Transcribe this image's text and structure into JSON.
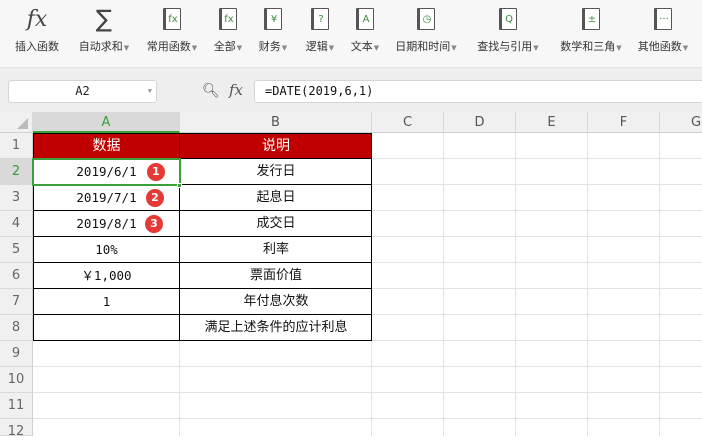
{
  "toolbar": [
    {
      "label": "插入函数",
      "icon": "fx-icon",
      "caret": false
    },
    {
      "label": "自动求和",
      "icon": "sigma-icon",
      "caret": true
    },
    {
      "label": "常用函数",
      "icon": "fx-star-icon",
      "caret": true
    },
    {
      "label": "全部",
      "icon": "fx-book-icon",
      "caret": true
    },
    {
      "label": "财务",
      "icon": "yen-book-icon",
      "caret": true
    },
    {
      "label": "逻辑",
      "icon": "question-book-icon",
      "caret": true
    },
    {
      "label": "文本",
      "icon": "text-book-icon",
      "caret": true
    },
    {
      "label": "日期和时间",
      "icon": "clock-book-icon",
      "caret": true
    },
    {
      "label": "查找与引用",
      "icon": "search-book-icon",
      "caret": true
    },
    {
      "label": "数学和三角",
      "icon": "math-book-icon",
      "caret": true
    },
    {
      "label": "其他函数",
      "icon": "more-book-icon",
      "caret": true
    }
  ],
  "icon_glyphs": {
    "fx": "fx",
    "sigma": "∑",
    "star": "fx",
    "all": "fx",
    "yen": "¥",
    "q": "?",
    "a": "A",
    "clock": "◷",
    "search": "Q",
    "math": "±",
    "more": "···"
  },
  "namebox": "A2",
  "formula": "=DATE(2019,6,1)",
  "fx_label": "fx",
  "columns": [
    "A",
    "B",
    "C",
    "D",
    "E",
    "F",
    "G"
  ],
  "rows": [
    "1",
    "2",
    "3",
    "4",
    "5",
    "6",
    "7",
    "8",
    "9",
    "10",
    "11",
    "12"
  ],
  "table": {
    "header": [
      "数据",
      "说明"
    ],
    "rows": [
      [
        "2019/6/1",
        "发行日",
        "1"
      ],
      [
        "2019/7/1",
        "起息日",
        "2"
      ],
      [
        "2019/8/1",
        "成交日",
        "3"
      ],
      [
        "10%",
        "利率",
        ""
      ],
      [
        "￥1,000",
        "票面价值",
        ""
      ],
      [
        "1",
        "年付息次数",
        ""
      ],
      [
        "",
        "满足上述条件的应计利息",
        ""
      ]
    ]
  },
  "colors": {
    "header_bg": "#c00000",
    "selection": "#3aa03a",
    "badge": "#e53935"
  }
}
